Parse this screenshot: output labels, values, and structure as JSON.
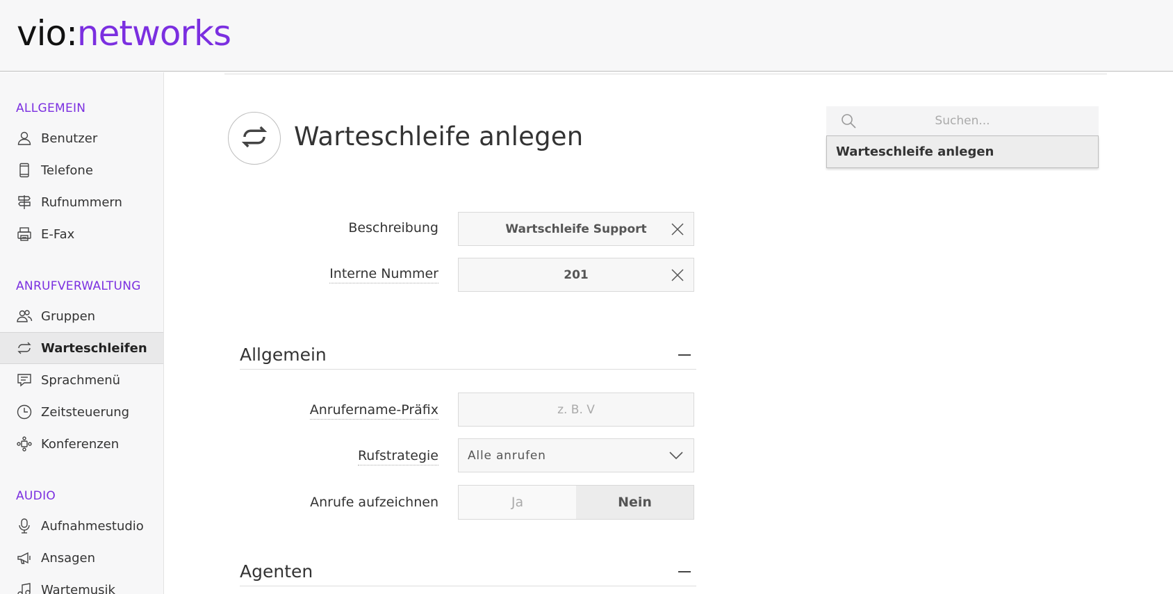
{
  "logo": {
    "part1": "vio:",
    "part2": "networks"
  },
  "sidebar": {
    "sections": [
      {
        "title": "ALLGEMEIN",
        "items": [
          {
            "label": "Benutzer",
            "icon": "user-icon"
          },
          {
            "label": "Telefone",
            "icon": "phone-icon"
          },
          {
            "label": "Rufnummern",
            "icon": "signpost-icon"
          },
          {
            "label": "E-Fax",
            "icon": "printer-icon"
          }
        ]
      },
      {
        "title": "ANRUFVERWALTUNG",
        "items": [
          {
            "label": "Gruppen",
            "icon": "group-icon"
          },
          {
            "label": "Warteschleifen",
            "icon": "loop-icon",
            "active": true
          },
          {
            "label": "Sprachmenü",
            "icon": "speech-icon"
          },
          {
            "label": "Zeitsteuerung",
            "icon": "clock-icon"
          },
          {
            "label": "Konferenzen",
            "icon": "conference-icon"
          }
        ]
      },
      {
        "title": "AUDIO",
        "items": [
          {
            "label": "Aufnahmestudio",
            "icon": "microphone-icon"
          },
          {
            "label": "Ansagen",
            "icon": "megaphone-icon"
          },
          {
            "label": "Wartemusik",
            "icon": "music-icon"
          }
        ]
      }
    ]
  },
  "page": {
    "title": "Warteschleife anlegen",
    "icon": "loop-icon"
  },
  "form": {
    "beschreibung": {
      "label": "Beschreibung",
      "value": "Wartschleife Support"
    },
    "interne_nummer": {
      "label": "Interne Nummer",
      "value": "201"
    },
    "section_allgemein": "Allgemein",
    "praefix": {
      "label": "Anrufername-Präfix",
      "placeholder": "z. B. V"
    },
    "rufstrategie": {
      "label": "Rufstrategie",
      "value": "Alle anrufen"
    },
    "aufzeichnen": {
      "label": "Anrufe aufzeichnen",
      "option_yes": "Ja",
      "option_no": "Nein",
      "selected": "Nein"
    },
    "section_agenten": "Agenten"
  },
  "search": {
    "placeholder": "Suchen...",
    "suggestion": "Warteschleife anlegen"
  },
  "colors": {
    "accent": "#7b2fe0"
  }
}
